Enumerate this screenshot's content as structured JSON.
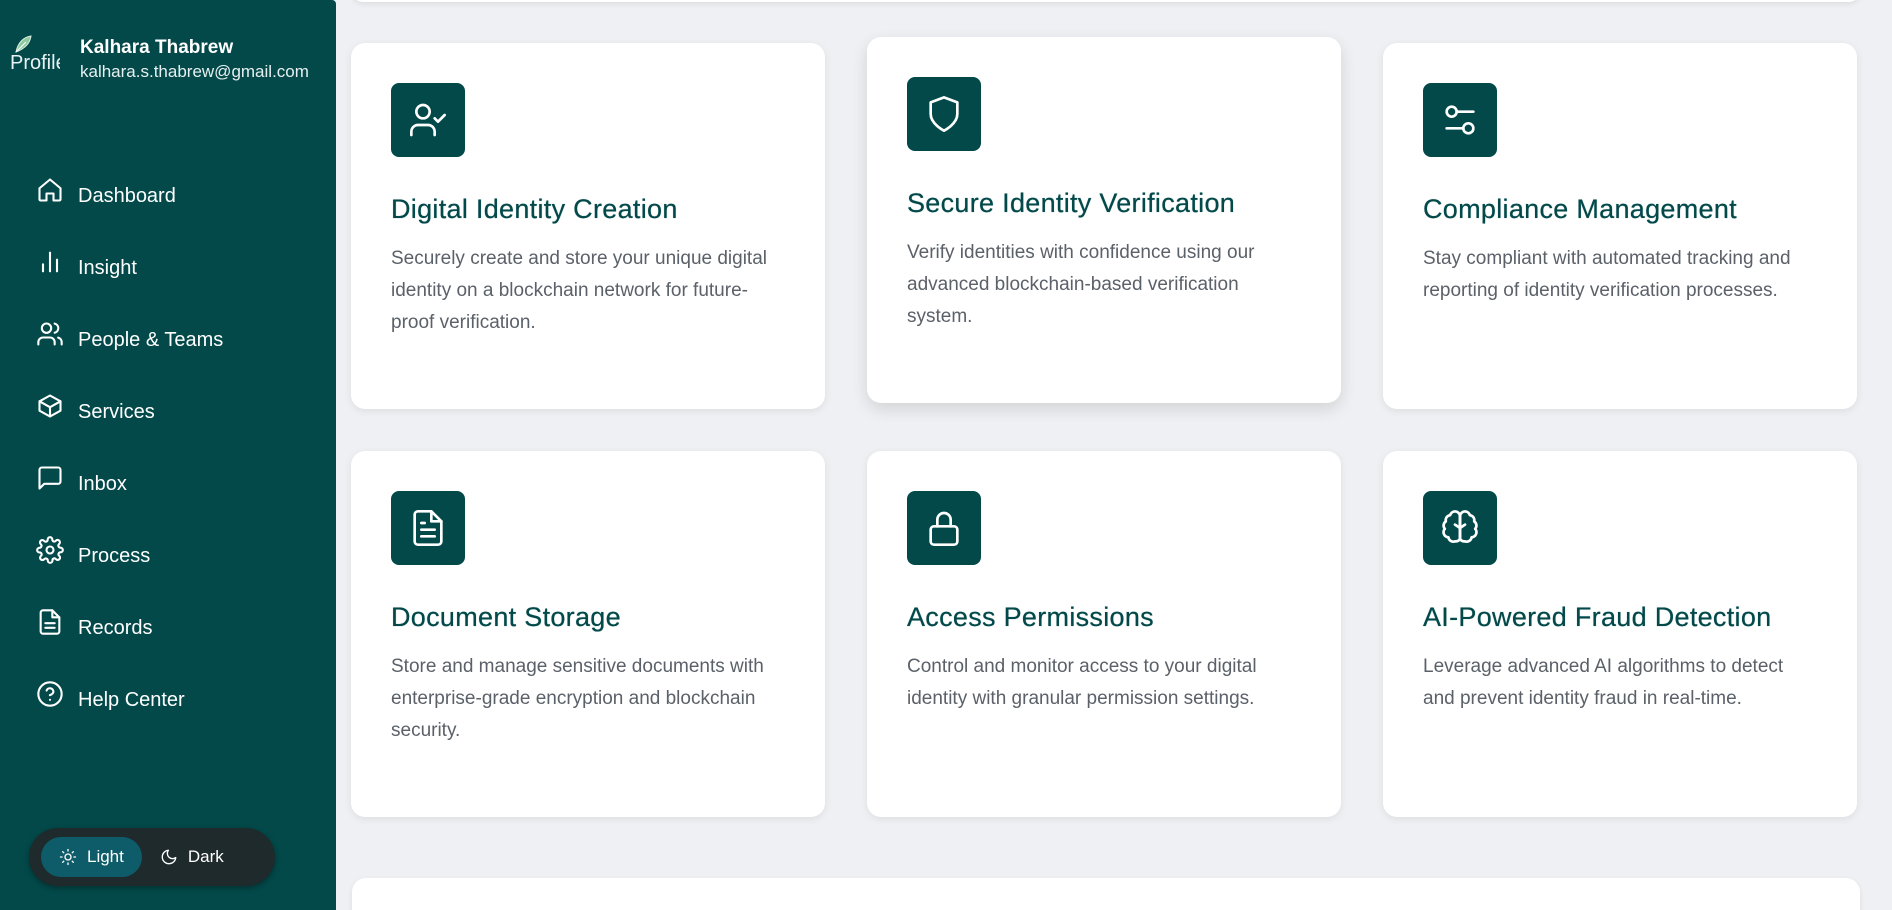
{
  "profile": {
    "avatar_alt": "Profile",
    "name": "Kalhara Thabrew",
    "email": "kalhara.s.thabrew@gmail.com"
  },
  "nav": {
    "items": [
      {
        "label": "Dashboard",
        "icon": "home-icon"
      },
      {
        "label": "Insight",
        "icon": "bar-chart-icon"
      },
      {
        "label": "People & Teams",
        "icon": "users-icon"
      },
      {
        "label": "Services",
        "icon": "box-icon"
      },
      {
        "label": "Inbox",
        "icon": "message-icon"
      },
      {
        "label": "Process",
        "icon": "gear-icon"
      },
      {
        "label": "Records",
        "icon": "document-icon"
      },
      {
        "label": "Help Center",
        "icon": "help-icon"
      }
    ]
  },
  "theme": {
    "light_label": "Light",
    "dark_label": "Dark",
    "selected": "Light"
  },
  "cards": [
    {
      "title": "Digital Identity Creation",
      "description": "Securely create and store your unique digital identity on a blockchain network for future-proof verification.",
      "icon": "user-check-icon"
    },
    {
      "title": "Secure Identity Verification",
      "description": "Verify identities with confidence using our advanced blockchain-based verification system.",
      "icon": "shield-icon"
    },
    {
      "title": "Compliance Management",
      "description": "Stay compliant with automated tracking and reporting of identity verification processes.",
      "icon": "toggles-icon"
    },
    {
      "title": "Document Storage",
      "description": "Store and manage sensitive documents with enterprise-grade encryption and blockchain security.",
      "icon": "file-text-icon"
    },
    {
      "title": "Access Permissions",
      "description": "Control and monitor access to your digital identity with granular permission settings.",
      "icon": "lock-icon"
    },
    {
      "title": "AI-Powered Fraud Detection",
      "description": "Leverage advanced AI algorithms to detect and prevent identity fraud in real-time.",
      "icon": "brain-icon"
    }
  ],
  "colors": {
    "sidebar_bg": "#03494a",
    "accent": "#03494a",
    "page_bg": "#eef0f3",
    "toggle_active": "#0e5c6a"
  }
}
